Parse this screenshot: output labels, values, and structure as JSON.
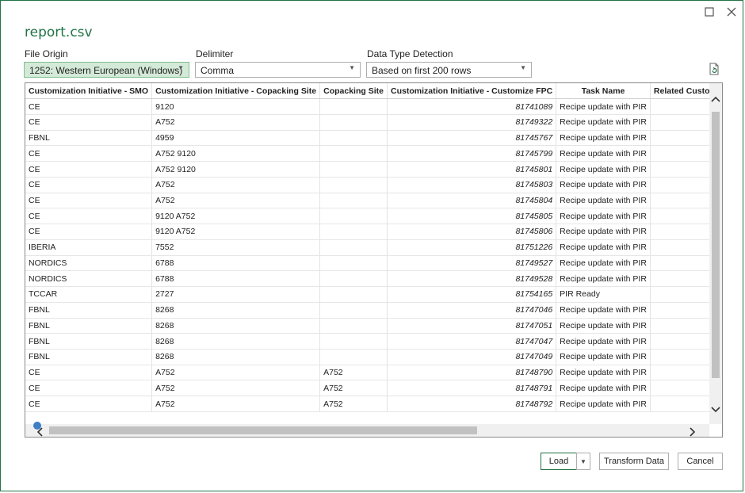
{
  "dialog": {
    "title": "report.csv"
  },
  "options": {
    "file_origin": {
      "label": "File Origin",
      "value": "1252: Western European (Windows)"
    },
    "delimiter": {
      "label": "Delimiter",
      "value": "Comma"
    },
    "type_detection": {
      "label": "Data Type Detection",
      "value": "Based on first 200 rows"
    }
  },
  "table": {
    "columns": [
      "Customization Initiative - SMO",
      "Customization Initiative - Copacking Site",
      "Copacking Site",
      "Customization Initiative - Customize FPC",
      "Task Name",
      "Related Customization"
    ],
    "rows": [
      [
        "CE",
        "9120",
        "",
        "81741089",
        "Recipe update with PIR",
        ""
      ],
      [
        "CE",
        "A752",
        "",
        "81749322",
        "Recipe update with PIR",
        ""
      ],
      [
        "FBNL",
        "4959",
        "",
        "81745767",
        "Recipe update with PIR",
        ""
      ],
      [
        "CE",
        "A752 9120",
        "",
        "81745799",
        "Recipe update with PIR",
        ""
      ],
      [
        "CE",
        "A752 9120",
        "",
        "81745801",
        "Recipe update with PIR",
        ""
      ],
      [
        "CE",
        "A752",
        "",
        "81745803",
        "Recipe update with PIR",
        ""
      ],
      [
        "CE",
        "A752",
        "",
        "81745804",
        "Recipe update with PIR",
        ""
      ],
      [
        "CE",
        "9120 A752",
        "",
        "81745805",
        "Recipe update with PIR",
        ""
      ],
      [
        "CE",
        "9120 A752",
        "",
        "81745806",
        "Recipe update with PIR",
        ""
      ],
      [
        "IBERIA",
        "7552",
        "",
        "81751226",
        "Recipe update with PIR",
        ""
      ],
      [
        "NORDICS",
        "6788",
        "",
        "81749527",
        "Recipe update with PIR",
        ""
      ],
      [
        "NORDICS",
        "6788",
        "",
        "81749528",
        "Recipe update with PIR",
        ""
      ],
      [
        "TCCAR",
        "2727",
        "",
        "81754165",
        "PIR Ready",
        ""
      ],
      [
        "FBNL",
        "8268",
        "",
        "81747046",
        "Recipe update with PIR",
        ""
      ],
      [
        "FBNL",
        "8268",
        "",
        "81747051",
        "Recipe update with PIR",
        ""
      ],
      [
        "FBNL",
        "8268",
        "",
        "81747047",
        "Recipe update with PIR",
        ""
      ],
      [
        "FBNL",
        "8268",
        "",
        "81747049",
        "Recipe update with PIR",
        ""
      ],
      [
        "CE",
        "A752",
        "A752",
        "81748790",
        "Recipe update with PIR",
        ""
      ],
      [
        "CE",
        "A752",
        "A752",
        "81748791",
        "Recipe update with PIR",
        ""
      ],
      [
        "CE",
        "A752",
        "A752",
        "81748792",
        "Recipe update with PIR",
        ""
      ]
    ]
  },
  "buttons": {
    "load": "Load",
    "transform": "Transform Data",
    "cancel": "Cancel"
  },
  "icons": {
    "maximize": "maximize-icon",
    "close": "close-icon",
    "refresh": "refresh-icon",
    "dropdown": "chevron-down-icon",
    "scroll_up": "scroll-up-icon",
    "scroll_down": "scroll-down-icon",
    "scroll_left": "scroll-left-icon",
    "scroll_right": "scroll-right-icon",
    "loading": "loading-icon"
  },
  "colors": {
    "accent": "#217346",
    "selected_dropdown": "#d4ead8"
  }
}
